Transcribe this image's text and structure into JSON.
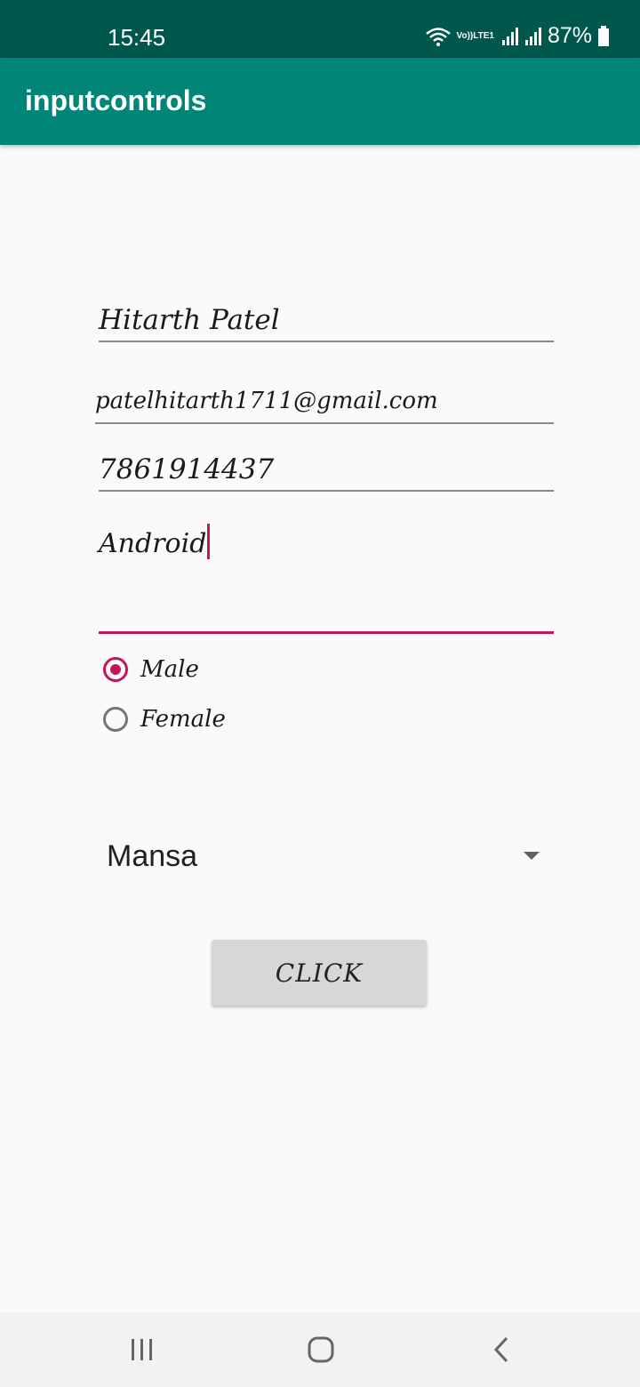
{
  "status_bar": {
    "time": "15:45",
    "volte_label_top": "Vo))",
    "volte_label_bottom": "LTE1",
    "battery_percent": "87%",
    "icons": [
      "wifi-icon",
      "volte-icon",
      "signal-icon",
      "signal-icon",
      "battery-icon"
    ]
  },
  "app_bar": {
    "title": "inputcontrols"
  },
  "form": {
    "name_value": "Hitarth Patel",
    "email_value": "patelhitarth1711@gmail.com",
    "phone_value": "7861914437",
    "multiline_value": "Android"
  },
  "gender": {
    "options": [
      {
        "label": "Male",
        "checked": true
      },
      {
        "label": "Female",
        "checked": false
      }
    ]
  },
  "spinner": {
    "selected": "Mansa"
  },
  "button": {
    "label": "CLICK"
  },
  "nav_bar": {
    "icons": [
      "recent-apps-icon",
      "home-icon",
      "back-icon"
    ]
  },
  "colors": {
    "status_bar": "#00574b",
    "app_bar": "#008577",
    "accent": "#c2185b"
  }
}
